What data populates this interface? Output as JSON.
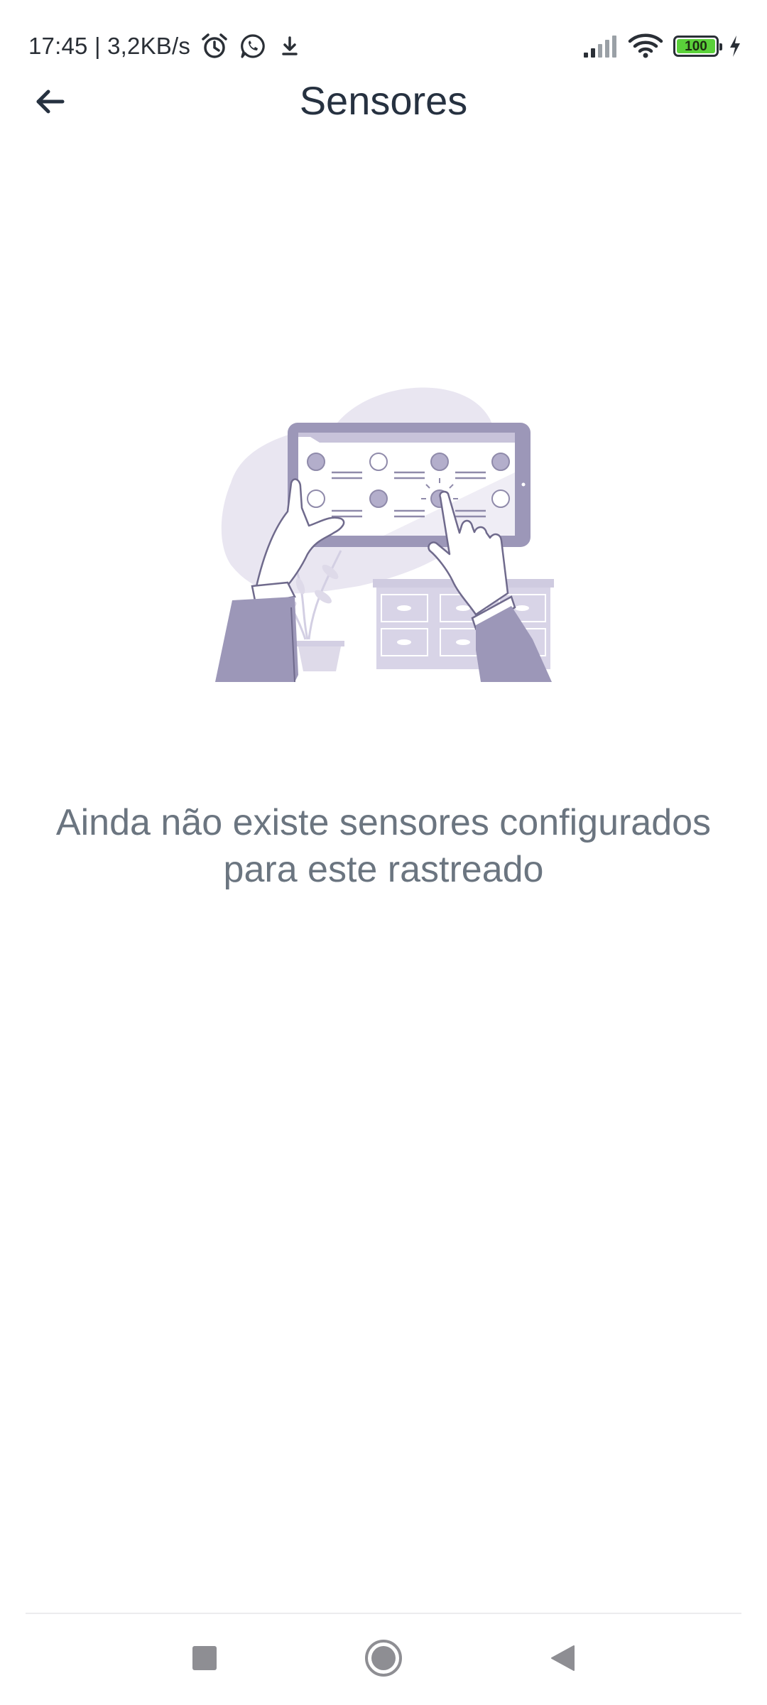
{
  "status_bar": {
    "time_speed": "17:45 | 3,2KB/s",
    "battery_level": "100",
    "battery_color": "#5ad13a",
    "icons": [
      "alarm-icon",
      "whatsapp-icon",
      "download-icon",
      "signal-icon",
      "wifi-icon",
      "battery-icon",
      "charging-icon"
    ]
  },
  "app_bar": {
    "title": "Sensores",
    "back_icon": "arrow-left-icon"
  },
  "empty_state": {
    "message": "Ainda não existe sensores configurados para este rastreado",
    "illustration": "hands-tablet-illustration",
    "accent_color": "#9c97b8",
    "background_color": "#e9e6f1"
  },
  "nav_bar": {
    "icons": [
      "recents-square-icon",
      "home-circle-icon",
      "back-triangle-icon"
    ]
  }
}
